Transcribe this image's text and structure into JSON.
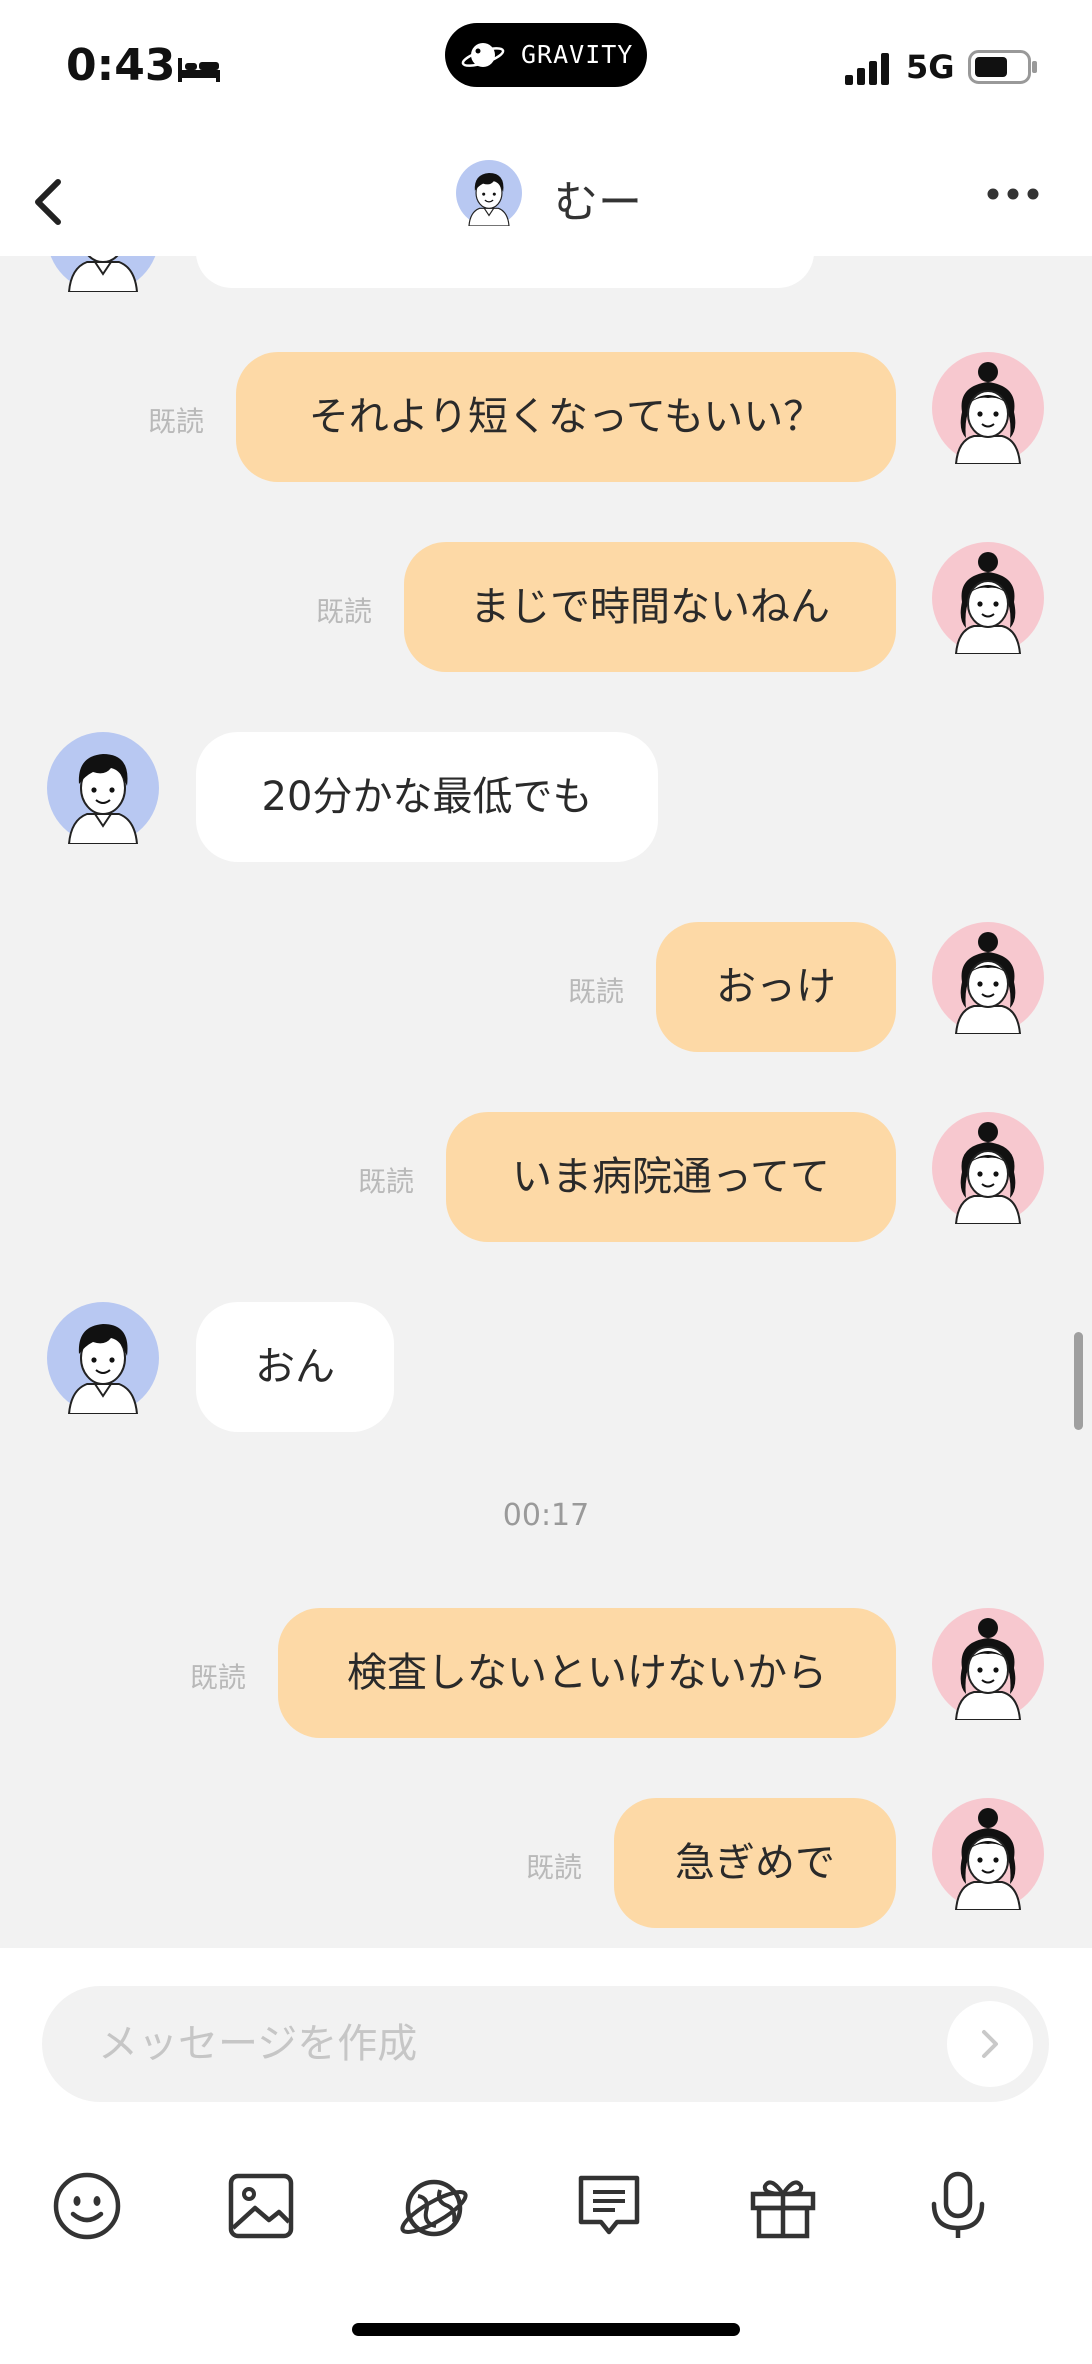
{
  "status_bar": {
    "time": "0:43",
    "brand": "GRAVITY",
    "network": "5G"
  },
  "header": {
    "contact_name": "むー"
  },
  "messages": [
    {
      "side": "me",
      "text": "それより短くなってもいい？",
      "read": "既読"
    },
    {
      "side": "me",
      "text": "まじで時間ないねん",
      "read": "既読"
    },
    {
      "side": "other",
      "text": "20分かな最低でも"
    },
    {
      "side": "me",
      "text": "おっけ",
      "read": "既読"
    },
    {
      "side": "me",
      "text": "いま病院通ってて",
      "read": "既読"
    },
    {
      "side": "other",
      "text": "おん"
    },
    {
      "timestamp": "00:17"
    },
    {
      "side": "me",
      "text": "検査しないといけないから",
      "read": "既読"
    },
    {
      "side": "me",
      "text": "急ぎめで",
      "read": "既読"
    }
  ],
  "composer": {
    "placeholder": "メッセージを作成",
    "tools": [
      "emoji-icon",
      "image-icon",
      "planet-icon",
      "quick-reply-icon",
      "gift-icon",
      "microphone-icon"
    ]
  },
  "colors": {
    "my_bubble": "#fdd9a6",
    "their_bubble": "#ffffff",
    "my_avatar_bg": "#f7c8cf",
    "their_avatar_bg": "#b8c8f2"
  }
}
